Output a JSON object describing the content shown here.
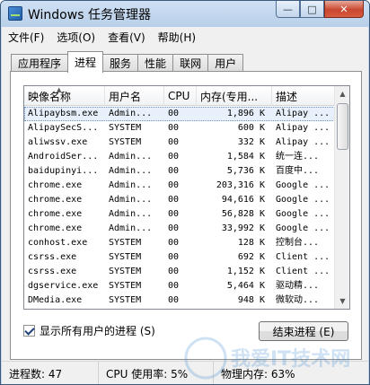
{
  "window": {
    "title": "Windows 任务管理器",
    "minimize": "—",
    "maximize": "□",
    "close": "✕"
  },
  "menu": [
    "文件(F)",
    "选项(O)",
    "查看(V)",
    "帮助(H)"
  ],
  "tabs": [
    "应用程序",
    "进程",
    "服务",
    "性能",
    "联网",
    "用户"
  ],
  "active_tab": "进程",
  "columns": [
    "映像名称",
    "用户名",
    "CPU",
    "内存(专用...",
    "描述"
  ],
  "processes": [
    [
      "Alipaybsm.exe",
      "Admin...",
      "00",
      "1,896 K",
      "Alipay ..."
    ],
    [
      "AlipaySecS...",
      "SYSTEM",
      "00",
      "600 K",
      "Alipay ..."
    ],
    [
      "aliwssv.exe",
      "SYSTEM",
      "00",
      "332 K",
      "Alipay ..."
    ],
    [
      "AndroidSer...",
      "Admin...",
      "00",
      "1,584 K",
      "统一连..."
    ],
    [
      "baidupinyi...",
      "Admin...",
      "00",
      "5,736 K",
      "百度中..."
    ],
    [
      "chrome.exe",
      "Admin...",
      "00",
      "203,316 K",
      "Google ..."
    ],
    [
      "chrome.exe",
      "Admin...",
      "00",
      "94,616 K",
      "Google ..."
    ],
    [
      "chrome.exe",
      "Admin...",
      "00",
      "56,828 K",
      "Google ..."
    ],
    [
      "chrome.exe",
      "Admin...",
      "00",
      "33,992 K",
      "Google ..."
    ],
    [
      "conhost.exe",
      "SYSTEM",
      "00",
      "128 K",
      "控制台..."
    ],
    [
      "csrss.exe",
      "SYSTEM",
      "00",
      "692 K",
      "Client ..."
    ],
    [
      "csrss.exe",
      "SYSTEM",
      "00",
      "1,152 K",
      "Client ..."
    ],
    [
      "dgservice.exe",
      "SYSTEM",
      "00",
      "5,464 K",
      "驱动精..."
    ],
    [
      "DMedia.exe",
      "SYSTEM",
      "00",
      "948 K",
      "微软动..."
    ]
  ],
  "show_all_label": "显示所有用户的进程 (S)",
  "show_all_checked": true,
  "end_process_label": "结束进程 (E)",
  "status": {
    "processes": "进程数: 47",
    "cpu": "CPU 使用率: 5%",
    "memory": "物理内存: 63%"
  },
  "watermark_text": "我爱IT技术网"
}
